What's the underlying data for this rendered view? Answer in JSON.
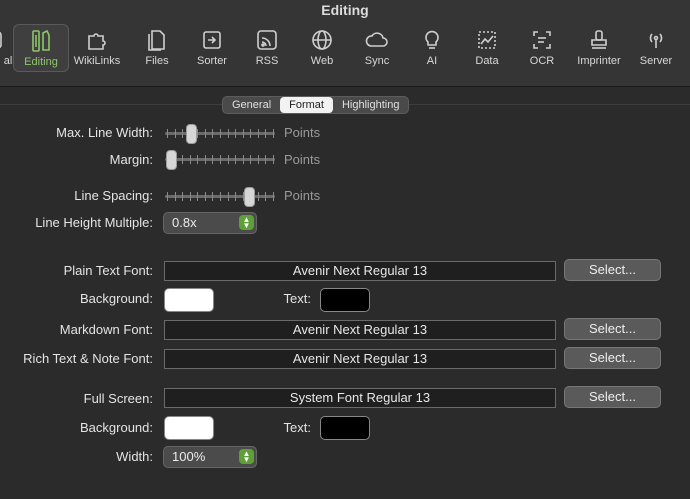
{
  "window": {
    "title": "Editing"
  },
  "toolbar": {
    "items": [
      {
        "label": "al",
        "icon": "general-icon"
      },
      {
        "label": "Editing",
        "icon": "pencil-ruler-icon",
        "active": true
      },
      {
        "label": "WikiLinks",
        "icon": "puzzle-icon"
      },
      {
        "label": "Files",
        "icon": "files-icon"
      },
      {
        "label": "Sorter",
        "icon": "sorter-icon"
      },
      {
        "label": "RSS",
        "icon": "rss-icon"
      },
      {
        "label": "Web",
        "icon": "globe-icon"
      },
      {
        "label": "Sync",
        "icon": "cloud-icon"
      },
      {
        "label": "AI",
        "icon": "lightbulb-icon"
      },
      {
        "label": "Data",
        "icon": "data-icon"
      },
      {
        "label": "OCR",
        "icon": "ocr-icon"
      },
      {
        "label": "Imprinter",
        "icon": "stamp-icon"
      },
      {
        "label": "Server",
        "icon": "antenna-icon"
      }
    ]
  },
  "tabs": [
    {
      "label": "General"
    },
    {
      "label": "Format",
      "selected": true
    },
    {
      "label": "Highlighting"
    }
  ],
  "format": {
    "max_line_width": {
      "label": "Max. Line Width:",
      "unit": "Points",
      "level": 0.2
    },
    "margin": {
      "label": "Margin:",
      "unit": "Points",
      "level": 0.0
    },
    "line_spacing": {
      "label": "Line Spacing:",
      "unit": "Points",
      "level": 0.78
    },
    "line_height_multiple": {
      "label": "Line Height Multiple:",
      "value": "0.8x"
    },
    "plain_text_font": {
      "label": "Plain Text Font:",
      "value": "Avenir Next Regular 13",
      "button": "Select..."
    },
    "plain_background": {
      "label": "Background:",
      "color": "#ffffff"
    },
    "plain_text_color": {
      "label": "Text:",
      "color": "#000000"
    },
    "markdown_font": {
      "label": "Markdown Font:",
      "value": "Avenir Next Regular 13",
      "button": "Select..."
    },
    "rich_text_font": {
      "label": "Rich Text & Note Font:",
      "value": "Avenir Next Regular 13",
      "button": "Select..."
    },
    "full_screen_font": {
      "label": "Full Screen:",
      "value": "System Font Regular 13",
      "button": "Select..."
    },
    "full_background": {
      "label": "Background:",
      "color": "#ffffff"
    },
    "full_text_color": {
      "label": "Text:",
      "color": "#000000"
    },
    "width": {
      "label": "Width:",
      "value": "100%"
    }
  },
  "colors": {
    "accent": "#8fc46a",
    "stepper_green": "#5f9f3a"
  }
}
